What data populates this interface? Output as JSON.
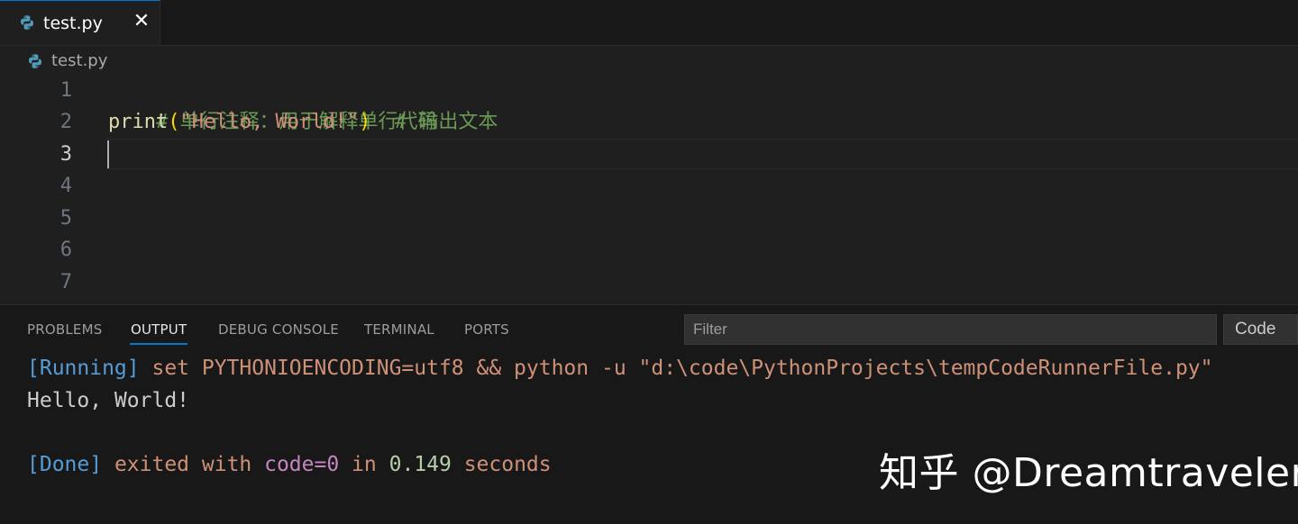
{
  "tab": {
    "filename": "test.py",
    "close_glyph": "✕"
  },
  "breadcrumb": {
    "file": "test.py"
  },
  "editor": {
    "line_numbers": [
      "1",
      "2",
      "3",
      "4",
      "5",
      "6",
      "7"
    ],
    "active_line": "3",
    "line1": {
      "comment": "# 单行注释：用于解释单行代码"
    },
    "line2": {
      "fn": "print",
      "open": "(",
      "str": "\"Hello, World!\"",
      "close": ")",
      "gap": "  ",
      "comment": "# 输出文本"
    }
  },
  "panel": {
    "tabs": [
      "PROBLEMS",
      "OUTPUT",
      "DEBUG CONSOLE",
      "TERMINAL",
      "PORTS"
    ],
    "active_tab": "OUTPUT",
    "filter_placeholder": "Filter",
    "channel": "Code"
  },
  "output": {
    "running_tag": "[Running]",
    "running_cmd": " set PYTHONIOENCODING=utf8 && python -u \"d:\\code\\PythonProjects\\tempCodeRunnerFile.py\"",
    "program_output": "Hello, World!",
    "done_tag": "[Done]",
    "done_exited": " exited with ",
    "done_code": "code=0",
    "done_in": " in ",
    "done_time": "0.149",
    "done_seconds": " seconds"
  },
  "watermark": "知乎 @Dreamtraveler",
  "colors": {
    "editor_bg": "#1f1f1f",
    "panel_bg": "#181818",
    "accent": "#0078d4",
    "comment": "#6a9955",
    "string": "#ce9178",
    "function": "#dcdcaa"
  }
}
